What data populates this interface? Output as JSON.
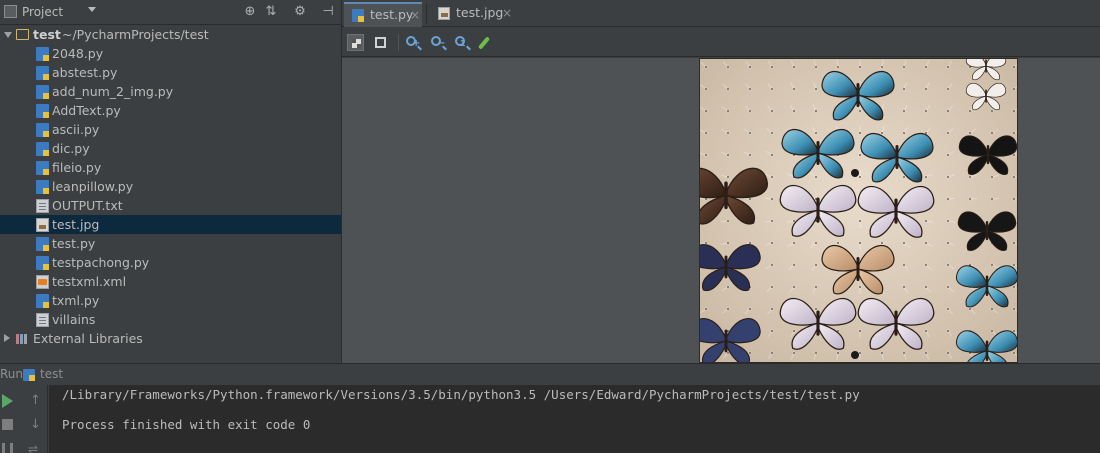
{
  "project_panel": {
    "title": "Project",
    "header_icons": [
      "target-icon",
      "collapse-icon",
      "gear-icon",
      "hide-icon"
    ],
    "root": {
      "name": "test",
      "path": "~/PycharmProjects/test"
    },
    "files": [
      {
        "name": "2048.py",
        "icon": "python-file-icon"
      },
      {
        "name": "abstest.py",
        "icon": "python-file-icon"
      },
      {
        "name": "add_num_2_img.py",
        "icon": "python-file-icon"
      },
      {
        "name": "AddText.py",
        "icon": "python-file-icon"
      },
      {
        "name": "ascii.py",
        "icon": "python-file-icon"
      },
      {
        "name": "dic.py",
        "icon": "python-file-icon"
      },
      {
        "name": "fileio.py",
        "icon": "python-file-icon"
      },
      {
        "name": "leanpillow.py",
        "icon": "python-file-icon"
      },
      {
        "name": "OUTPUT.txt",
        "icon": "text-file-icon"
      },
      {
        "name": "test.jpg",
        "icon": "image-file-icon",
        "selected": true
      },
      {
        "name": "test.py",
        "icon": "python-file-icon"
      },
      {
        "name": "testpachong.py",
        "icon": "python-file-icon"
      },
      {
        "name": "testxml.xml",
        "icon": "xml-file-icon"
      },
      {
        "name": "txml.py",
        "icon": "python-file-icon"
      },
      {
        "name": "villains",
        "icon": "text-file-icon"
      }
    ],
    "external_libraries": "External Libraries"
  },
  "editor": {
    "tabs": [
      {
        "label": "test.py",
        "close": "×",
        "active": true
      },
      {
        "label": "test.jpg",
        "close": "×",
        "active": false
      }
    ],
    "toolbar_icons": [
      "chessboard-icon",
      "grid-icon",
      "zoom-in-icon",
      "zoom-out-icon",
      "actual-size-icon",
      "color-picker-icon"
    ],
    "image_content": "butterfly specimen collection photo"
  },
  "run_panel": {
    "title": "Run",
    "config_name": "test",
    "console": [
      "/Library/Frameworks/Python.framework/Versions/3.5/bin/python3.5 /Users/Edward/PycharmProjects/test/test.py",
      "Process finished with exit code 0"
    ]
  },
  "colors": {
    "background": "#3c3f41",
    "selection": "#0d293e",
    "console_bg": "#2b2b2b",
    "run_green": "#59a869"
  }
}
